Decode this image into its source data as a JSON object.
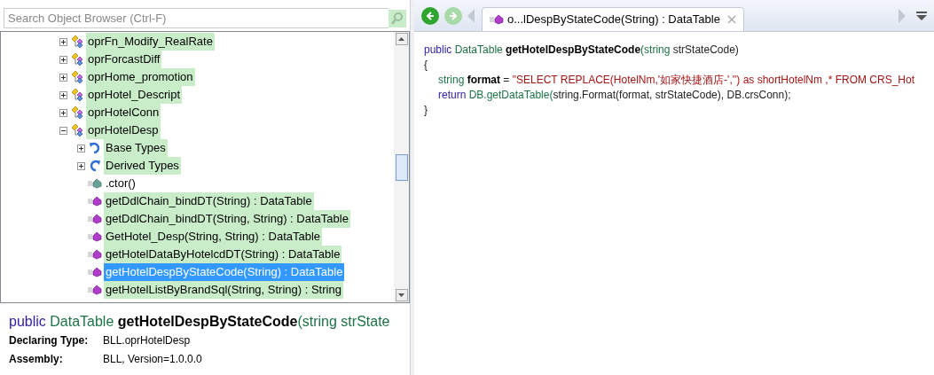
{
  "search": {
    "placeholder": "Search Object Browser (Ctrl-F)"
  },
  "tree": {
    "items": [
      {
        "label": "oprFn_Modify_RealRate",
        "kind": "class",
        "expanded": false,
        "highlighted": true,
        "selected": false
      },
      {
        "label": "oprForcastDiff",
        "kind": "class",
        "expanded": false,
        "highlighted": true,
        "selected": false
      },
      {
        "label": "oprHome_promotion",
        "kind": "class",
        "expanded": false,
        "highlighted": true,
        "selected": false
      },
      {
        "label": "oprHotel_Descript",
        "kind": "class",
        "expanded": false,
        "highlighted": true,
        "selected": false
      },
      {
        "label": "oprHotelConn",
        "kind": "class",
        "expanded": false,
        "highlighted": true,
        "selected": false
      },
      {
        "label": "oprHotelDesp",
        "kind": "class",
        "expanded": true,
        "highlighted": true,
        "selected": false,
        "children": [
          {
            "label": "Base Types",
            "kind": "base",
            "expanded": false,
            "highlighted": true,
            "selected": false
          },
          {
            "label": "Derived Types",
            "kind": "derived",
            "expanded": false,
            "highlighted": true,
            "selected": false
          },
          {
            "label": ".ctor()",
            "kind": "ctor",
            "highlighted": false,
            "selected": false
          },
          {
            "label": "getDdlChain_bindDT(String) : DataTable",
            "kind": "method",
            "highlighted": true,
            "selected": false
          },
          {
            "label": "getDdlChain_bindDT(String, String) : DataTable",
            "kind": "method",
            "highlighted": true,
            "selected": false
          },
          {
            "label": "GetHotel_Desp(String, String) : DataTable",
            "kind": "method",
            "highlighted": true,
            "selected": false
          },
          {
            "label": "getHotelDataByHotelcdDT(String) : DataTable",
            "kind": "method",
            "highlighted": true,
            "selected": false
          },
          {
            "label": "getHotelDespByStateCode(String) : DataTable",
            "kind": "method",
            "selected": true
          },
          {
            "label": "getHotelListByBrandSql(String, String) : String",
            "kind": "method",
            "highlighted": true,
            "selected": false
          }
        ]
      }
    ]
  },
  "details": {
    "signature": [
      {
        "kind": "keyword",
        "text": "public "
      },
      {
        "kind": "type",
        "text": "DataTable "
      },
      {
        "kind": "name",
        "text": "getHotelDespByStateCode"
      },
      {
        "kind": "type",
        "text": "(string strState"
      }
    ],
    "fields": [
      {
        "label": "Declaring Type:",
        "value": "BLL.oprHotelDesp"
      },
      {
        "label": "Assembly:",
        "value": "BLL, Version=1.0.0.0"
      }
    ]
  },
  "tab": {
    "title": "o...lDespByStateCode(String) : DataTable",
    "selected": true
  },
  "nav": {
    "back_disabled": false,
    "forward_disabled": true
  },
  "code": [
    [
      {
        "kind": "keyword",
        "text": "public "
      },
      {
        "kind": "type",
        "text": "DataTable "
      },
      {
        "kind": "name",
        "text": "getHotelDespByStateCode"
      },
      {
        "kind": "type",
        "text": "(string "
      },
      {
        "kind": "plain",
        "text": "strStateCode)"
      }
    ],
    [
      {
        "kind": "plain",
        "text": "{"
      }
    ],
    [
      {
        "kind": "indent"
      },
      {
        "kind": "type",
        "text": "string "
      },
      {
        "kind": "name",
        "text": "format"
      },
      {
        "kind": "plain",
        "text": " = "
      },
      {
        "kind": "string",
        "text": "\"SELECT REPLACE(HotelNm,'如家快捷酒店-','') as shortHotelNm ,* FROM CRS_Hot"
      }
    ],
    [
      {
        "kind": "indent"
      },
      {
        "kind": "keyword",
        "text": "return "
      },
      {
        "kind": "type",
        "text": "DB.getDataTable("
      },
      {
        "kind": "plain",
        "text": "string.Format(format, strStateCode), DB.crsConn);"
      }
    ],
    [
      {
        "kind": "plain",
        "text": "}"
      }
    ]
  ]
}
